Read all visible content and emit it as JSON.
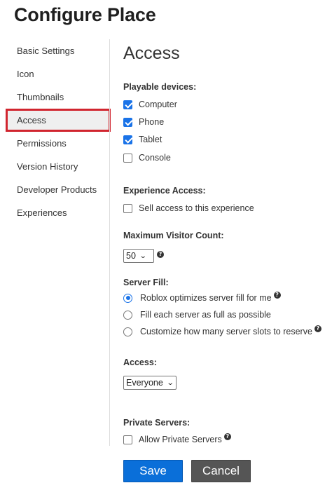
{
  "page": {
    "title": "Configure Place"
  },
  "sidebar": {
    "items": [
      {
        "label": "Basic Settings",
        "active": false
      },
      {
        "label": "Icon",
        "active": false
      },
      {
        "label": "Thumbnails",
        "active": false
      },
      {
        "label": "Access",
        "active": true
      },
      {
        "label": "Permissions",
        "active": false
      },
      {
        "label": "Version History",
        "active": false
      },
      {
        "label": "Developer Products",
        "active": false
      },
      {
        "label": "Experiences",
        "active": false
      }
    ],
    "highlight_color": "#d1252f"
  },
  "main": {
    "heading": "Access",
    "playable_devices": {
      "label": "Playable devices:",
      "options": [
        {
          "label": "Computer",
          "checked": true
        },
        {
          "label": "Phone",
          "checked": true
        },
        {
          "label": "Tablet",
          "checked": true
        },
        {
          "label": "Console",
          "checked": false
        }
      ]
    },
    "experience_access": {
      "label": "Experience Access:",
      "sell_access": {
        "label": "Sell access to this experience",
        "checked": false
      }
    },
    "max_visitor": {
      "label": "Maximum Visitor Count:",
      "value": "50",
      "help": "?"
    },
    "server_fill": {
      "label": "Server Fill:",
      "options": [
        {
          "label": "Roblox optimizes server fill for me",
          "selected": true,
          "help": "?"
        },
        {
          "label": "Fill each server as full as possible",
          "selected": false
        },
        {
          "label": "Customize how many server slots to reserve",
          "selected": false,
          "help": "?"
        }
      ]
    },
    "access": {
      "label": "Access:",
      "value": "Everyone"
    },
    "private_servers": {
      "label": "Private Servers:",
      "allow": {
        "label": "Allow Private Servers",
        "checked": false,
        "help": "?"
      }
    }
  },
  "buttons": {
    "save_label": "Save",
    "cancel_label": "Cancel",
    "save_color": "#0a6fd9",
    "cancel_color": "#555555"
  },
  "icons": {
    "checkbox_checked": "checkbox-checked-icon",
    "checkbox_unchecked": "checkbox-unchecked-icon",
    "radio_selected": "radio-selected-icon",
    "radio_unselected": "radio-unselected-icon",
    "help": "question-circle-icon",
    "dropdown": "chevron-down-icon"
  }
}
